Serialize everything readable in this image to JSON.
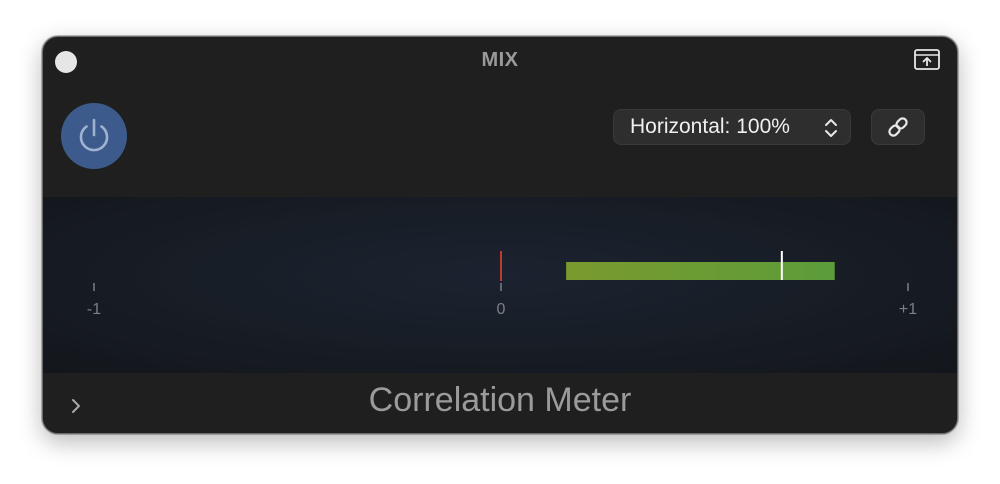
{
  "window": {
    "title": "MIX"
  },
  "header": {
    "power_on": true,
    "mode_select": {
      "value": "Horizontal: 100%"
    }
  },
  "meter": {
    "scale_min": -1,
    "scale_max": 1,
    "tick_labels": [
      "-1",
      "0",
      "+1"
    ],
    "range_low": 0.16,
    "range_high": 0.82,
    "current_value": 0.69
  },
  "footer": {
    "plugin_name": "Correlation Meter"
  },
  "colors": {
    "power_accent": "#3d5a8c",
    "negative": "#c0392b",
    "neutral": "#e0c030",
    "positive": "#6ab04c",
    "range_bar_left": "#7a9a2e",
    "range_bar_right": "#5c9c3a"
  },
  "icons": {
    "close": "close-icon",
    "detach": "detach-window-icon",
    "power": "power-icon",
    "select_chevrons": "up-down-chevron-icon",
    "link": "link-icon",
    "expand": "chevron-right-icon"
  }
}
